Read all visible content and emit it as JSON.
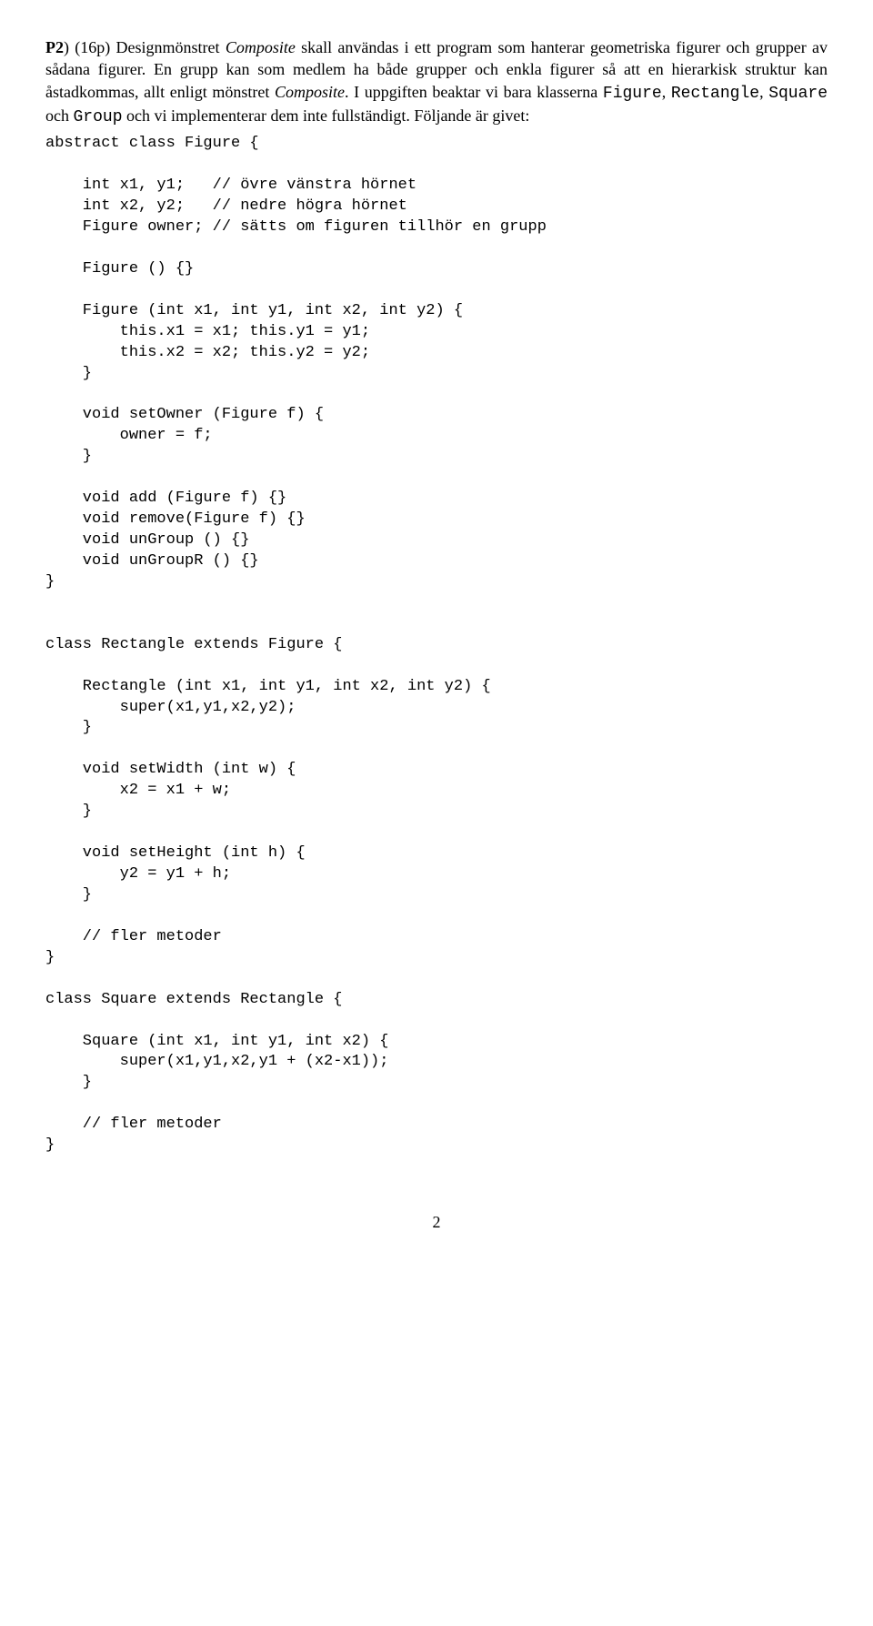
{
  "heading": {
    "label": "P2",
    "points": "(16p)",
    "text1": " Designmönstret ",
    "composite1": "Composite",
    "text2": " skall användas i ett program som hanterar geometriska figurer och grupper av sådana figurer. En grupp kan som medlem ha både grupper och enkla figurer så att en hierarkisk struktur kan åstadkommas, allt enligt mönstret ",
    "composite2": "Composite",
    "text3": ". I uppgiften beaktar vi bara klasserna ",
    "cls1": "Figure",
    "c1": ", ",
    "cls2": "Rectangle",
    "c2": ", ",
    "cls3": "Square",
    "c3": " och ",
    "cls4": "Group",
    "text4": " och vi implementerar dem inte fullständigt. Följande är givet:"
  },
  "code": "abstract class Figure {\n\n    int x1, y1;   // övre vänstra hörnet\n    int x2, y2;   // nedre högra hörnet\n    Figure owner; // sätts om figuren tillhör en grupp\n\n    Figure () {}\n\n    Figure (int x1, int y1, int x2, int y2) {\n        this.x1 = x1; this.y1 = y1;\n        this.x2 = x2; this.y2 = y2;\n    }\n\n    void setOwner (Figure f) {\n        owner = f;\n    }\n\n    void add (Figure f) {}\n    void remove(Figure f) {}\n    void unGroup () {}\n    void unGroupR () {}\n}\n\n\nclass Rectangle extends Figure {\n\n    Rectangle (int x1, int y1, int x2, int y2) {\n        super(x1,y1,x2,y2);\n    }\n\n    void setWidth (int w) {\n        x2 = x1 + w;\n    }\n\n    void setHeight (int h) {\n        y2 = y1 + h;\n    }\n\n    // fler metoder\n}\n\nclass Square extends Rectangle {\n\n    Square (int x1, int y1, int x2) {\n        super(x1,y1,x2,y1 + (x2-x1));\n    }\n\n    // fler metoder\n}",
  "pagenum": "2"
}
